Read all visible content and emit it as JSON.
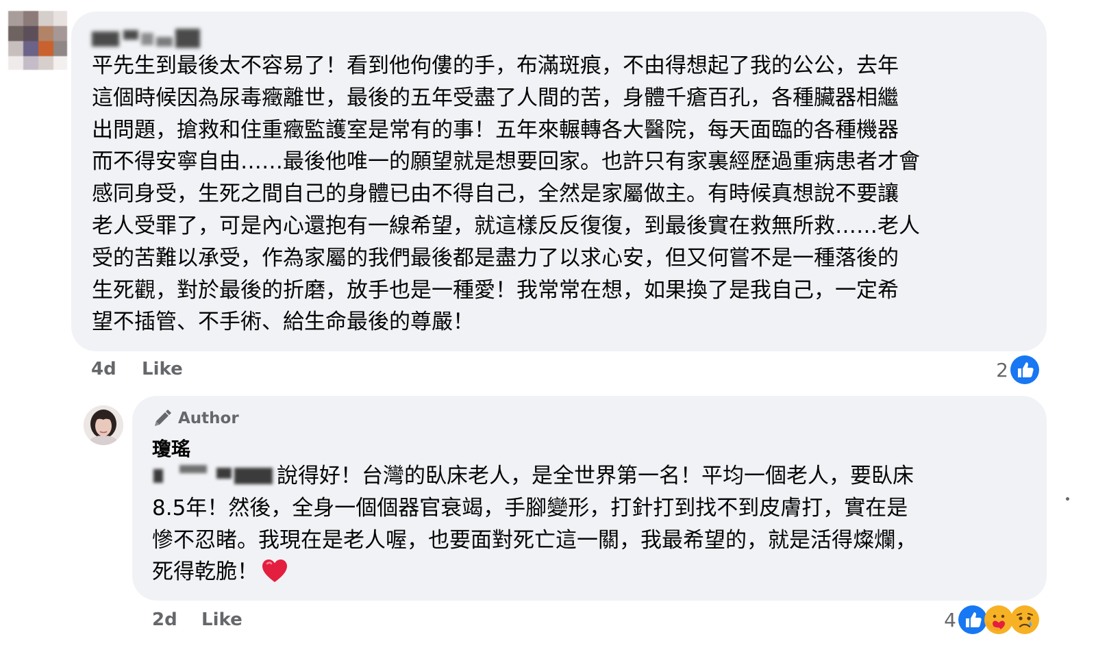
{
  "comments": [
    {
      "author_name": "",
      "text": "平先生到最後太不容易了！看到他佝僂的手，布滿斑痕，不由得想起了我的公公，去年\n這個時候因為尿毒癥離世，最後的五年受盡了人間的苦，身體千瘡百孔，各種臟器相繼\n出問題，搶救和住重癥監護室是常有的事！五年來輾轉各大醫院，每天面臨的各種機器\n而不得安寧自由……最後他唯一的願望就是想要回家。也許只有家裏經歷過重病患者才會\n感同身受，生死之間自己的身體已由不得自己，全然是家屬做主。有時候真想說不要讓\n老人受罪了，可是內心還抱有一線希望，就這樣反反復復，到最後實在救無所救……老人\n受的苦難以承受，作為家屬的我們最後都是盡力了以求心安，但又何嘗不是一種落後的\n生死觀，對於最後的折磨，放手也是一種愛！我常常在想，如果換了是我自己，一定希\n望不插管、不手術、給生命最後的尊嚴！",
      "time": "4d",
      "like_label": "Like",
      "reaction_count": "2",
      "reactions": [
        "like-icon"
      ]
    },
    {
      "badge_label": "Author",
      "author_name": "瓊瑤",
      "text": "說得好！台灣的臥床老人，是全世界第一名！平均一個老人，要臥床\n8.5年！然後，全身一個個器官衰竭，手腳變形，打針打到找不到皮膚打，實在是\n慘不忍睹。我現在是老人喔，也要面對死亡這一關，我最希望的，就是活得燦爛，\n死得乾脆！",
      "time": "2d",
      "like_label": "Like",
      "reaction_count": "4",
      "reactions": [
        "like-icon",
        "care-icon",
        "sad-icon"
      ]
    }
  ],
  "colors": {
    "bubble": "#f0f2f5",
    "meta_text": "#65676b",
    "like_blue": "#1877f2",
    "heart_red": "#e41e3f"
  }
}
